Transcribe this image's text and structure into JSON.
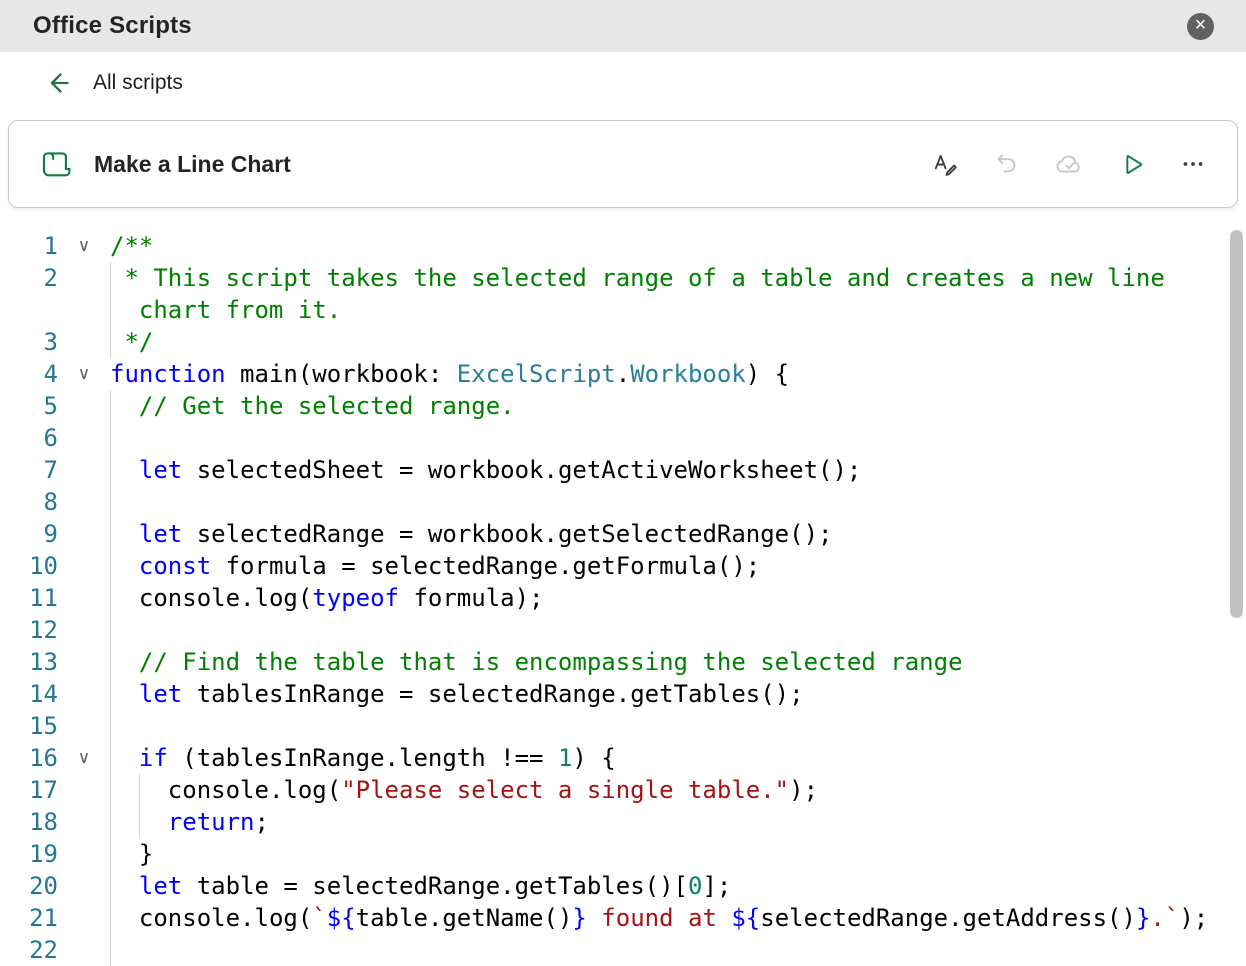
{
  "colors": {
    "accent": "#107C41",
    "header_bg": "#e7e7e7",
    "title_color": "#242424",
    "icon_color": "#3d3d3d",
    "disabled_icon": "#c6c6c6",
    "border": "#c9c9c9",
    "guide": "#d6d6d6",
    "scrollbar": "#c2c2c2",
    "back_arrow": "#217346",
    "close_bg": "#616161",
    "line_number": "#237893"
  },
  "header": {
    "title": "Office Scripts",
    "close_glyph": "×"
  },
  "nav": {
    "back_label": "All scripts"
  },
  "card": {
    "title": "Make a Line Chart",
    "actions": [
      {
        "id": "rename",
        "icon": "rename-icon",
        "disabled": false
      },
      {
        "id": "undo",
        "icon": "undo-icon",
        "disabled": true
      },
      {
        "id": "cloud-saved",
        "icon": "cloud-saved-icon",
        "disabled": true
      },
      {
        "id": "run",
        "icon": "run-icon",
        "disabled": false
      },
      {
        "id": "more",
        "icon": "more-icon",
        "disabled": false
      }
    ]
  },
  "editor": {
    "language": "typescript",
    "fold_glyph": "∨",
    "token_colors": {
      "c": "#008000",
      "k": "#0000FF",
      "t": "#267F99",
      "s": "#A31515",
      "n": "#098658",
      "i": "#0000FF",
      "p": "#000000"
    },
    "lines": [
      {
        "num": "1",
        "fold": true,
        "tokens": [
          [
            "c",
            "/**"
          ]
        ]
      },
      {
        "num": "2",
        "fold": false,
        "tokens": [
          [
            "c",
            " * This script takes the selected range of a table and creates a new line chart from it."
          ]
        ]
      },
      {
        "num": "3",
        "fold": false,
        "tokens": [
          [
            "c",
            " */"
          ]
        ]
      },
      {
        "num": "4",
        "fold": true,
        "tokens": [
          [
            "k",
            "function"
          ],
          [
            "p",
            " main(workbook: "
          ],
          [
            "t",
            "ExcelScript"
          ],
          [
            "p",
            "."
          ],
          [
            "t",
            "Workbook"
          ],
          [
            "p",
            ") {"
          ]
        ]
      },
      {
        "num": "5",
        "fold": false,
        "tokens": [
          [
            "c",
            "  // Get the selected range."
          ]
        ]
      },
      {
        "num": "6",
        "fold": false,
        "tokens": []
      },
      {
        "num": "7",
        "fold": false,
        "tokens": [
          [
            "p",
            "  "
          ],
          [
            "k",
            "let"
          ],
          [
            "p",
            " selectedSheet = workbook.getActiveWorksheet();"
          ]
        ]
      },
      {
        "num": "8",
        "fold": false,
        "tokens": []
      },
      {
        "num": "9",
        "fold": false,
        "tokens": [
          [
            "p",
            "  "
          ],
          [
            "k",
            "let"
          ],
          [
            "p",
            " selectedRange = workbook.getSelectedRange();"
          ]
        ]
      },
      {
        "num": "10",
        "fold": false,
        "tokens": [
          [
            "p",
            "  "
          ],
          [
            "k",
            "const"
          ],
          [
            "p",
            " formula = selectedRange.getFormula();"
          ]
        ]
      },
      {
        "num": "11",
        "fold": false,
        "tokens": [
          [
            "p",
            "  console.log("
          ],
          [
            "k",
            "typeof"
          ],
          [
            "p",
            " formula);"
          ]
        ]
      },
      {
        "num": "12",
        "fold": false,
        "tokens": []
      },
      {
        "num": "13",
        "fold": false,
        "tokens": [
          [
            "c",
            "  // Find the table that is encompassing the selected range"
          ]
        ]
      },
      {
        "num": "14",
        "fold": false,
        "tokens": [
          [
            "p",
            "  "
          ],
          [
            "k",
            "let"
          ],
          [
            "p",
            " tablesInRange = selectedRange.getTables();"
          ]
        ]
      },
      {
        "num": "15",
        "fold": false,
        "tokens": []
      },
      {
        "num": "16",
        "fold": true,
        "tokens": [
          [
            "p",
            "  "
          ],
          [
            "k",
            "if"
          ],
          [
            "p",
            " (tablesInRange.length !== "
          ],
          [
            "n",
            "1"
          ],
          [
            "p",
            ") {"
          ]
        ]
      },
      {
        "num": "17",
        "fold": false,
        "tokens": [
          [
            "p",
            "    console.log("
          ],
          [
            "s",
            "\"Please select a single table.\""
          ],
          [
            "p",
            ");"
          ]
        ]
      },
      {
        "num": "18",
        "fold": false,
        "tokens": [
          [
            "p",
            "    "
          ],
          [
            "k",
            "return"
          ],
          [
            "p",
            ";"
          ]
        ]
      },
      {
        "num": "19",
        "fold": false,
        "tokens": [
          [
            "p",
            "  }"
          ]
        ]
      },
      {
        "num": "20",
        "fold": false,
        "tokens": [
          [
            "p",
            "  "
          ],
          [
            "k",
            "let"
          ],
          [
            "p",
            " table = selectedRange.getTables()["
          ],
          [
            "n",
            "0"
          ],
          [
            "p",
            "];"
          ]
        ]
      },
      {
        "num": "21",
        "fold": false,
        "tokens": [
          [
            "p",
            "  console.log("
          ],
          [
            "s",
            "`"
          ],
          [
            "i",
            "${"
          ],
          [
            "p",
            "table.getName()"
          ],
          [
            "i",
            "}"
          ],
          [
            "s",
            " found at "
          ],
          [
            "i",
            "${"
          ],
          [
            "p",
            "selectedRange.getAddress()"
          ],
          [
            "i",
            "}"
          ],
          [
            "s",
            ".`"
          ],
          [
            "p",
            ");"
          ]
        ]
      },
      {
        "num": "22",
        "fold": false,
        "tokens": []
      }
    ]
  }
}
